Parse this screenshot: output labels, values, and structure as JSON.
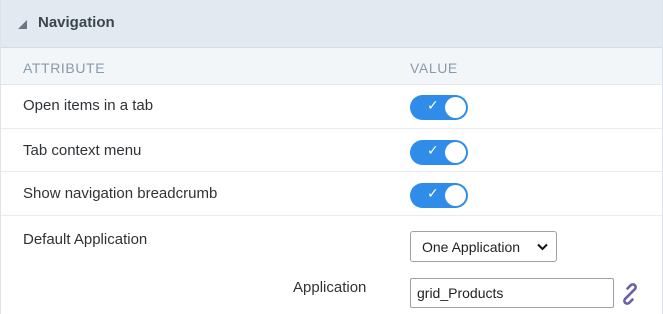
{
  "panel": {
    "title": "Navigation"
  },
  "columns": {
    "attribute": "ATTRIBUTE",
    "value": "VALUE"
  },
  "rows": [
    {
      "label": "Open items in a tab",
      "type": "toggle",
      "enabled": true
    },
    {
      "label": "Tab context menu",
      "type": "toggle",
      "enabled": true
    },
    {
      "label": "Show navigation breadcrumb",
      "type": "toggle",
      "enabled": true
    },
    {
      "label": "Default Application",
      "type": "select",
      "selected": "One Application"
    }
  ],
  "application": {
    "label": "Application",
    "value": "grid_Products"
  },
  "toggle": {
    "check_glyph": "✓"
  },
  "icons": {
    "collapse": "triangle-collapse-icon",
    "select_arrow": "chevron-down-icon",
    "link": "link-chain-icon"
  },
  "colors": {
    "accent": "#2f8ce9",
    "header_bg": "#e3e9f0",
    "column_header_bg": "#f3f6f9",
    "link_icon": "#6c5ea8"
  }
}
